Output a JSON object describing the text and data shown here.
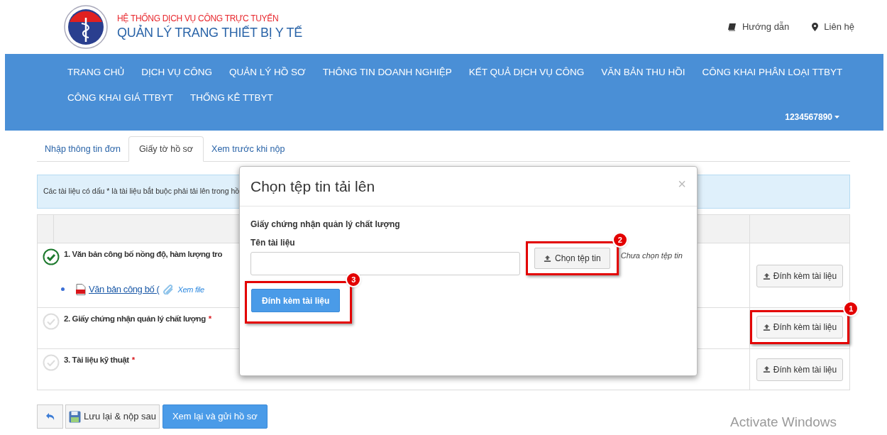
{
  "header": {
    "subtitle": "HỆ THỐNG DỊCH VỤ CÔNG TRỰC TUYẾN",
    "title": "QUẢN LÝ TRANG THIẾT BỊ Y TẾ",
    "links": [
      {
        "kind": "guide",
        "label": "Hướng dẫn"
      },
      {
        "kind": "contact",
        "label": "Liên hệ"
      }
    ]
  },
  "nav": {
    "items": [
      "TRANG CHỦ",
      "DỊCH VỤ CÔNG",
      "QUẢN LÝ HỒ SƠ",
      "THÔNG TIN DOANH NGHIỆP",
      "KẾT QUẢ DỊCH VỤ CÔNG",
      "VĂN BẢN THU HỒI",
      "CÔNG KHAI PHÂN LOẠI TTBYT",
      "CÔNG KHAI GIÁ TTBYT",
      "THỐNG KÊ TTBYT"
    ],
    "account": "1234567890"
  },
  "tabs": [
    {
      "label": "Nhập thông tin đơn",
      "selected": false
    },
    {
      "label": "Giấy tờ hồ sơ",
      "selected": true
    },
    {
      "label": "Xem trước khi nộp",
      "selected": false
    }
  ],
  "notice": "Các tài liệu có dấu * là tài liệu bắt buộc phải tải lên trong hồ",
  "documents": [
    {
      "title": "1. Văn bản công bố nồng độ, hàm lượng tro",
      "done": true,
      "files": [
        {
          "name": "Văn bản công bố (",
          "action": "Xem file"
        }
      ],
      "button": "Đính kèm tài liệu"
    },
    {
      "title": "2. Giấy chứng nhận quản lý chất lượng",
      "done": false,
      "required_mark": "*",
      "button": "Đính kèm tài liệu",
      "annotation": "1"
    },
    {
      "title": "3. Tài liệu kỹ thuật",
      "done": false,
      "required_mark": "*",
      "button": "Đính kèm tài liệu"
    }
  ],
  "modal": {
    "title": "Chọn tệp tin tải lên",
    "close": "×",
    "document": "Giấy chứng nhận quản lý chất lượng",
    "field_label": "Tên tài liệu",
    "choose_button": "Chọn tệp tin",
    "choose_annotation": "2",
    "file_status": "Chưa chọn tệp tin",
    "submit_button": "Đính kèm tài liệu",
    "submit_annotation": "3"
  },
  "footer": {
    "buttons": [
      {
        "kind": "undo"
      },
      {
        "kind": "save",
        "label": "Lưu lại & nộp sau"
      },
      {
        "kind": "primary",
        "label": "Xem lại và gửi hồ sơ"
      }
    ]
  },
  "os_notice": "Activate Windows"
}
